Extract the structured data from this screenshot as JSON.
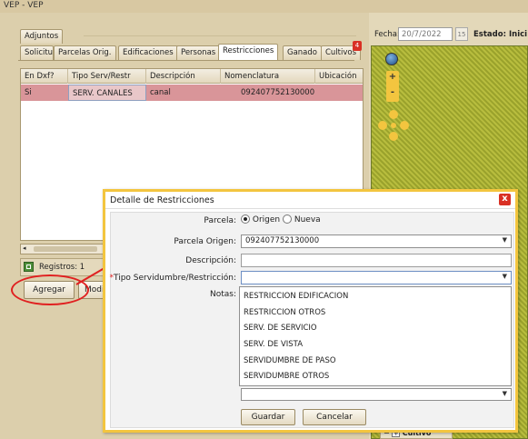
{
  "window": {
    "title": "VEP - VEP"
  },
  "tabs_row1": [
    "Adjuntos"
  ],
  "tabs_row2": [
    {
      "label": "Solicitu"
    },
    {
      "label": "Parcelas Orig."
    },
    {
      "label": "Edificaciones"
    },
    {
      "label": "Personas"
    },
    {
      "label": "Restricciones",
      "active": true
    },
    {
      "label": "Ganado"
    },
    {
      "label": "Cultivos"
    }
  ],
  "cultivos_badge": "4",
  "grid": {
    "columns": [
      "En Dxf?",
      "Tipo Serv/Restr",
      "Descripción",
      "Nomenclatura",
      "Ubicación"
    ],
    "rows": [
      [
        "Si",
        "SERV. CANALES",
        "canal",
        "092407752130000",
        ""
      ]
    ]
  },
  "pager": {
    "registros": "Registros: 1"
  },
  "buttons": {
    "agregar": "Agregar",
    "modificar": "Modif"
  },
  "right_header": {
    "fecha_label": "Fecha:",
    "fecha_value": "20/7/2022",
    "cal_label": "15",
    "estado_label": "Estado:",
    "estado_value": "Inici"
  },
  "map": {
    "zoom_in": "+",
    "zoom_out": "-",
    "layer_label": "Cultivo",
    "layer_prefix": "−",
    "layer_check": "+"
  },
  "dialog": {
    "title": "Detalle de Restricciones",
    "close": "x",
    "parcela_label": "Parcela:",
    "parcela_options": [
      "Origen",
      "Nueva"
    ],
    "parcela_selected": "Origen",
    "parcela_origen_label": "Parcela Origen:",
    "parcela_origen_value": "092407752130000",
    "descripcion_label": "Descripción:",
    "descripcion_value": "",
    "tipo_label_required": "*",
    "tipo_label": "Tipo Servidumbre/Restricción:",
    "tipo_value": "",
    "notas_label": "Notas:",
    "tipo_options": [
      "RESTRICCION EDIFICACION",
      "RESTRICCION OTROS",
      "SERV. DE SERVICIO",
      "SERV. DE VISTA",
      "SERVIDUMBRE DE PASO",
      "SERVIDUMBRE OTROS"
    ],
    "guardar": "Guardar",
    "cancelar": "Cancelar"
  },
  "colors": {
    "accent": "#f3c53f",
    "selected_row": "#d99599",
    "annotation": "#e02020"
  }
}
